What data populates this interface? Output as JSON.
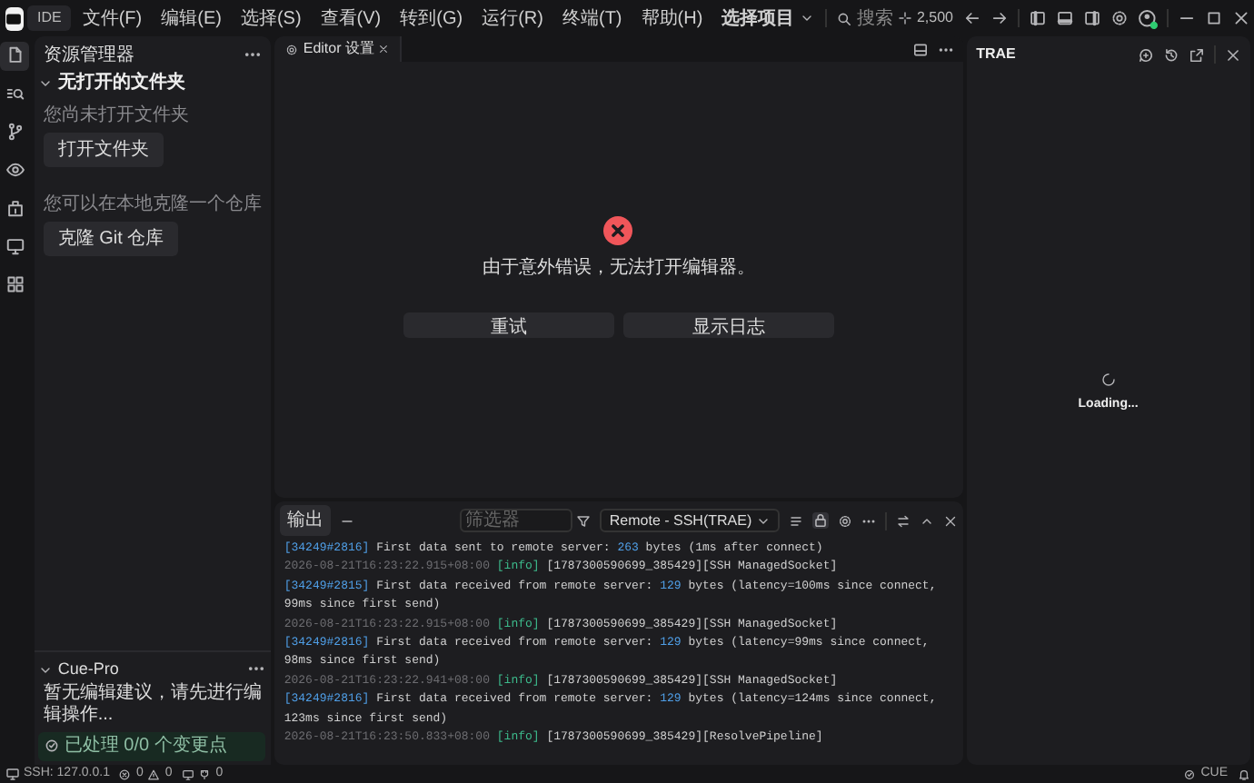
{
  "title_bar": {
    "logo": "IDE",
    "menus": [
      "文件(F)",
      "编辑(E)",
      "选择(S)",
      "查看(V)",
      "转到(G)",
      "运行(R)",
      "终端(T)",
      "帮助(H)"
    ],
    "project": "选择项目",
    "search_placeholder": "搜索",
    "credits": "2,500"
  },
  "activity_bar": {
    "items": [
      {
        "selected": true
      },
      {
        "selected": false
      },
      {
        "selected": false
      },
      {
        "selected": false
      },
      {
        "selected": false
      },
      {
        "selected": false
      },
      {
        "selected": false
      }
    ]
  },
  "explorer": {
    "title": "资源管理器",
    "section": "无打开的文件夹",
    "expanded": true,
    "no_folder_hint": "您尚未打开文件夹",
    "open_button": "打开文件夹",
    "clone_hint": "您可以在本地克隆一个仓库",
    "clone_button": "克隆 Git 仓库"
  },
  "cue_pro": {
    "title": "Cue-Pro",
    "expanded": true,
    "message": "暂无编辑建议，请先进行编辑操作...",
    "status": "已处理 0/0 个变更点"
  },
  "editor": {
    "tabs": [
      {
        "label": "Editor 设置",
        "selected": true
      }
    ],
    "error": "由于意外错误，无法打开编辑器。",
    "buttons": [
      "重试",
      "显示日志"
    ]
  },
  "output": {
    "title": "输出",
    "filter_placeholder": "筛选器",
    "channel": "Remote - SSH(TRAE)",
    "lines": [
      {
        "kind": "message",
        "tag": "[34249#2816]",
        "text": "First data sent to remote server:",
        "bytes": "263",
        "rest": "bytes (1ms after connect)"
      },
      {
        "kind": "meta",
        "time": "2026-08-21T16:23:22.915+08:00",
        "level": "[info]",
        "source": "[1787300590699_385429][SSH ManagedSocket]"
      },
      {
        "kind": "message",
        "tag": "[34249#2815]",
        "text": "First data received from remote server:",
        "bytes": "129",
        "rest": "bytes (latency=100ms since connect, 99ms since first send)"
      },
      {
        "kind": "meta",
        "time": "2026-08-21T16:23:22.915+08:00",
        "level": "[info]",
        "source": "[1787300590699_385429][SSH ManagedSocket]"
      },
      {
        "kind": "message",
        "tag": "[34249#2816]",
        "text": "First data received from remote server:",
        "bytes": "129",
        "rest": "bytes (latency=99ms since connect, 98ms since first send)"
      },
      {
        "kind": "meta",
        "time": "2026-08-21T16:23:22.941+08:00",
        "level": "[info]",
        "source": "[1787300590699_385429][SSH ManagedSocket]"
      },
      {
        "kind": "message",
        "tag": "[34249#2816]",
        "text": "First data received from remote server:",
        "bytes": "129",
        "rest": "bytes (latency=124ms since connect, 123ms since first send)"
      },
      {
        "kind": "meta",
        "time": "2026-08-21T16:23:50.833+08:00",
        "level": "[info]",
        "source": "[1787300590699_385429][ResolvePipeline]"
      }
    ]
  },
  "trae_panel": {
    "title": "TRAE",
    "loading": "Loading..."
  },
  "status_bar": {
    "remote": "SSH: 127.0.0.1",
    "errors": "0",
    "warnings": "0",
    "ports": "0",
    "right": "CUE"
  }
}
